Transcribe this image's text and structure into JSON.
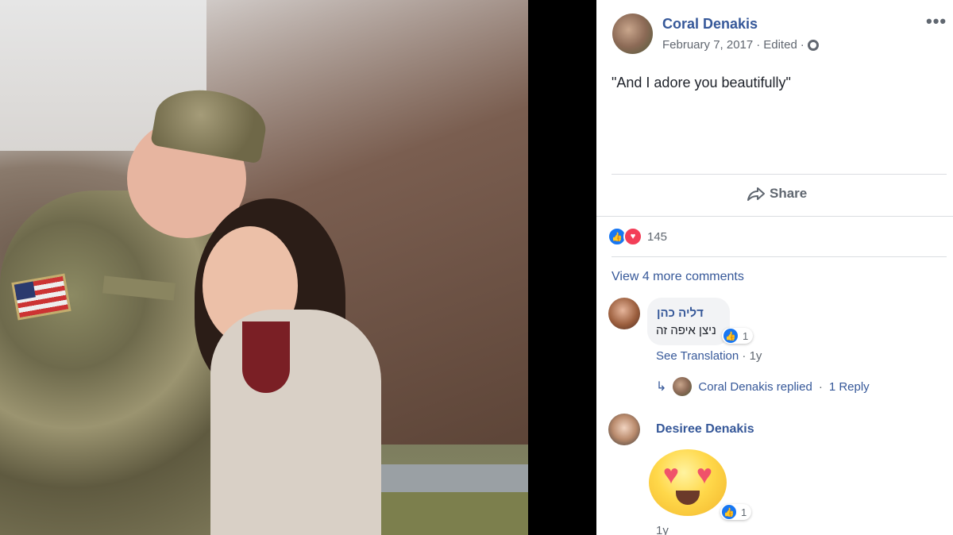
{
  "post": {
    "author": "Coral Denakis",
    "date": "February 7, 2017",
    "edited": "Edited",
    "privacy_icon": "globe-icon",
    "text": "\"And I adore you beautifully\""
  },
  "actions": {
    "share_label": "Share"
  },
  "reactions": {
    "count": "145",
    "types": [
      "like",
      "love"
    ]
  },
  "comments": {
    "view_more": "View 4 more comments",
    "items": [
      {
        "author": "דליה כהן",
        "text": "ניצן איפה זה",
        "likes": "1",
        "see_translation": "See Translation",
        "time": "1y",
        "reply_author": "Coral Denakis replied",
        "reply_count": "1 Reply"
      },
      {
        "author": "Desiree Denakis",
        "sticker": "heart-eyes-emoji",
        "likes": "1",
        "time": "1y"
      }
    ]
  },
  "colors": {
    "link": "#365899",
    "meta": "#616770",
    "like": "#1877f2",
    "love": "#f33e58"
  }
}
